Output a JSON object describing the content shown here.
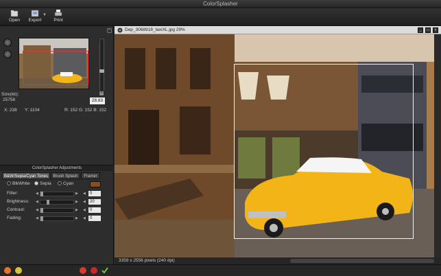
{
  "app": {
    "title": "ColorSplasher"
  },
  "toolbar": {
    "open_label": "Open",
    "export_label": "Export",
    "print_label": "Print"
  },
  "navigator": {
    "size_label": "Size(kb):",
    "size_value": "25756",
    "zoom_value": "28.83",
    "x_readout": "X: 238",
    "y_readout": "Y: 1104",
    "rgb_readout": "R: 152  G: 152  B: 152"
  },
  "adjustments": {
    "header": "ColorSplasher Adjustments",
    "tabs": [
      "B&W/Sepia/Cyan Tones",
      "Brush Splash",
      "Framer"
    ],
    "modes": [
      "BlkWhite",
      "Sepia",
      "Cyan"
    ],
    "selected_mode": "Sepia",
    "tone_color": "#8a4d1e",
    "rows": [
      {
        "label": "Filter:",
        "value": "0",
        "level": 0
      },
      {
        "label": "Brightness:",
        "value": "20",
        "level": 0.2
      },
      {
        "label": "Contrast:",
        "value": "0",
        "level": 0
      },
      {
        "label": "Fading:",
        "value": "0",
        "level": 0
      }
    ]
  },
  "viewer": {
    "title": "Dep_3068918_taxiXL.jpg 29%",
    "status": "3359 x 2556 pixels (240 dpi)"
  },
  "colors": {
    "accent_taxi": "#f2b417",
    "sepia": "#8a5a2e"
  }
}
